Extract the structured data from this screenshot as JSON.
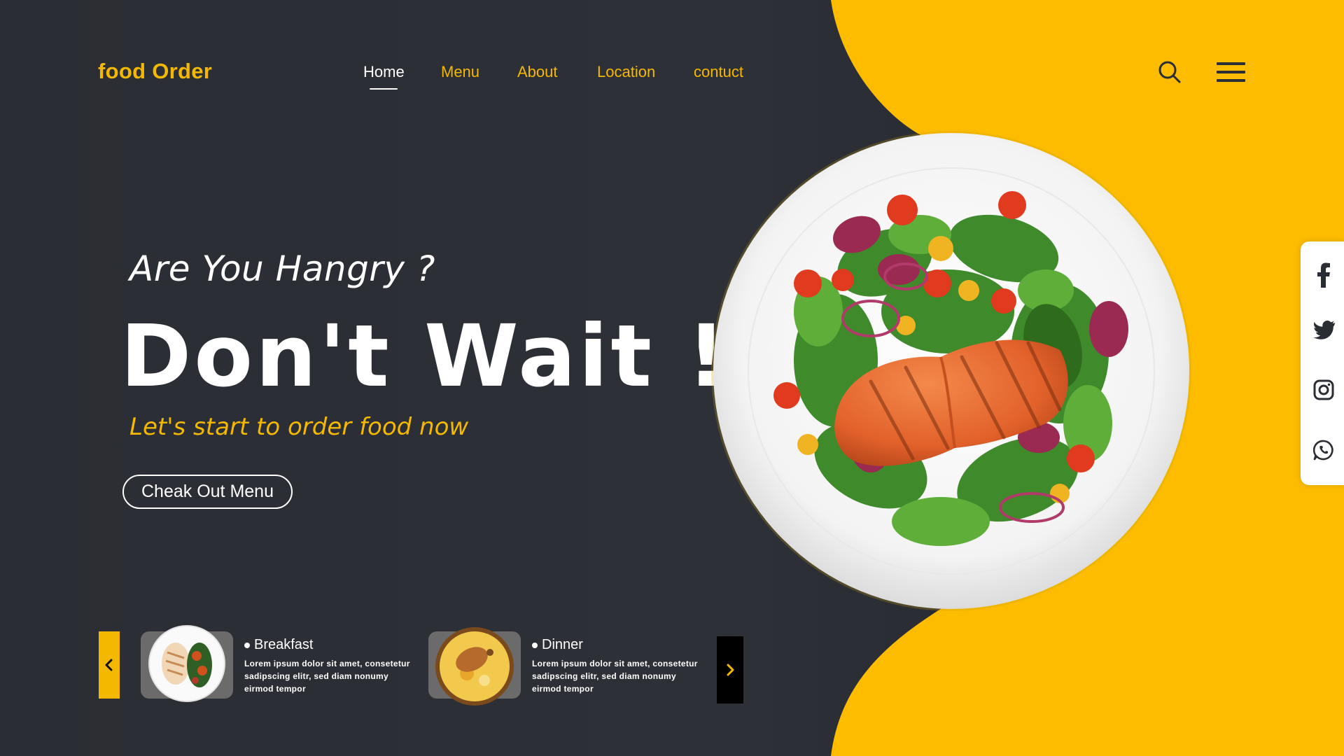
{
  "brand": {
    "name": "food Order"
  },
  "nav": {
    "items": [
      {
        "label": "Home",
        "active": true
      },
      {
        "label": "Menu",
        "active": false
      },
      {
        "label": "About",
        "active": false
      },
      {
        "label": "Location",
        "active": false
      },
      {
        "label": "contuct",
        "active": false
      }
    ]
  },
  "header_icons": [
    "search-icon",
    "menu-icon"
  ],
  "hero": {
    "kicker": "Are You Hangry ?",
    "title": "Don't Wait !",
    "subtitle": "Let's start to order food now",
    "cta_label": "Cheak Out Menu"
  },
  "carousel": {
    "cards": [
      {
        "title": "Breakfast",
        "description": "Lorem ipsum dolor sit amet, consetetur sadipscing elitr, sed diam nonumy eirmod tempor"
      },
      {
        "title": "Dinner",
        "description": "Lorem ipsum dolor sit amet, consetetur sadipscing elitr, sed diam nonumy eirmod tempor"
      }
    ],
    "prev_icon": "chevron-left-icon",
    "next_icon": "chevron-right-icon"
  },
  "social": [
    "facebook-icon",
    "twitter-icon",
    "instagram-icon",
    "whatsapp-icon"
  ],
  "colors": {
    "accent": "#f5b800",
    "background": "#2b2d34",
    "text": "#ffffff"
  }
}
